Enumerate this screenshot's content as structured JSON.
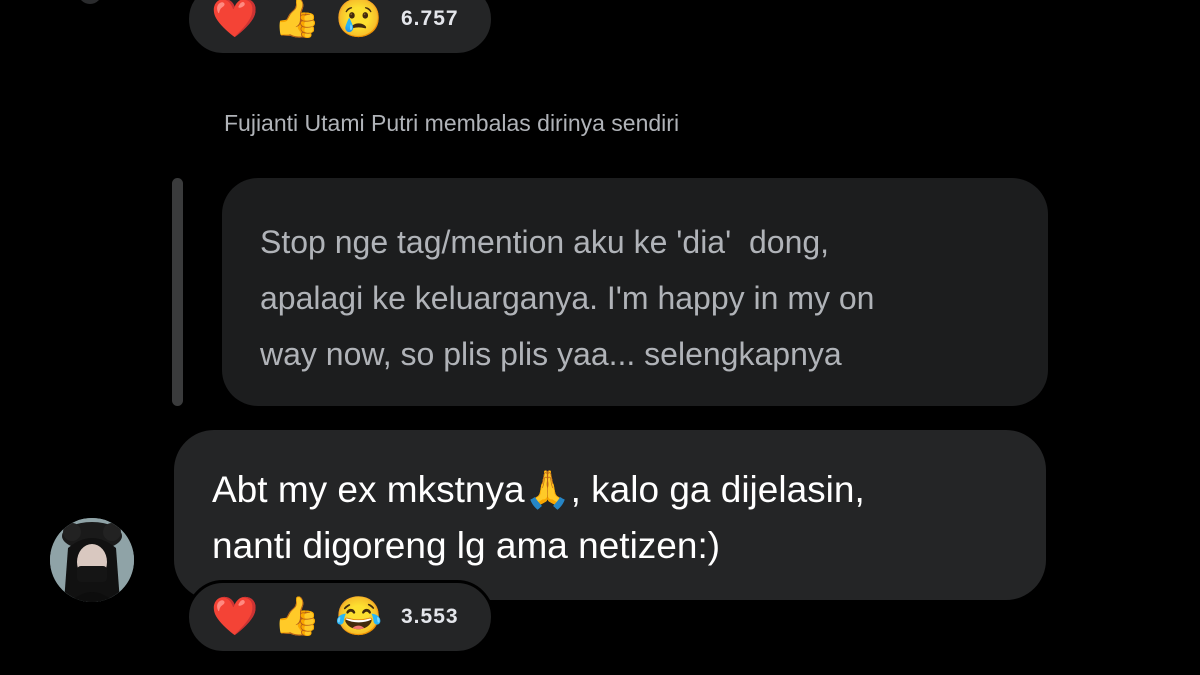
{
  "top_comment": {
    "reactions": [
      {
        "icon": "heart-icon",
        "glyph": "❤️"
      },
      {
        "icon": "thumbs-up-icon",
        "glyph": "👍"
      },
      {
        "icon": "sad-face-icon",
        "glyph": "😢"
      }
    ],
    "reaction_count": "6.757"
  },
  "reply": {
    "label": "Fujianti Utami Putri membalas dirinya sendiri",
    "lines": [
      "Stop nge tag/mention aku ke 'dia'  dong,",
      "apalagi ke keluarganya. I'm happy in my on",
      "way now, so plis plis yaa... selengkapnya"
    ]
  },
  "comment": {
    "lines": [
      "Abt my ex mkstnya🙏, kalo ga dijelasin,",
      "nanti digoreng lg ama netizen:)"
    ],
    "reactions": [
      {
        "icon": "heart-icon",
        "glyph": "❤️"
      },
      {
        "icon": "thumbs-up-icon",
        "glyph": "👍"
      },
      {
        "icon": "laughing-icon",
        "glyph": "😂"
      }
    ],
    "reaction_count": "3.553"
  },
  "colors": {
    "background": "#000000",
    "bubble": "#242526",
    "reply_bubble": "#1c1d1e",
    "secondary_text": "#b0b3b8"
  }
}
